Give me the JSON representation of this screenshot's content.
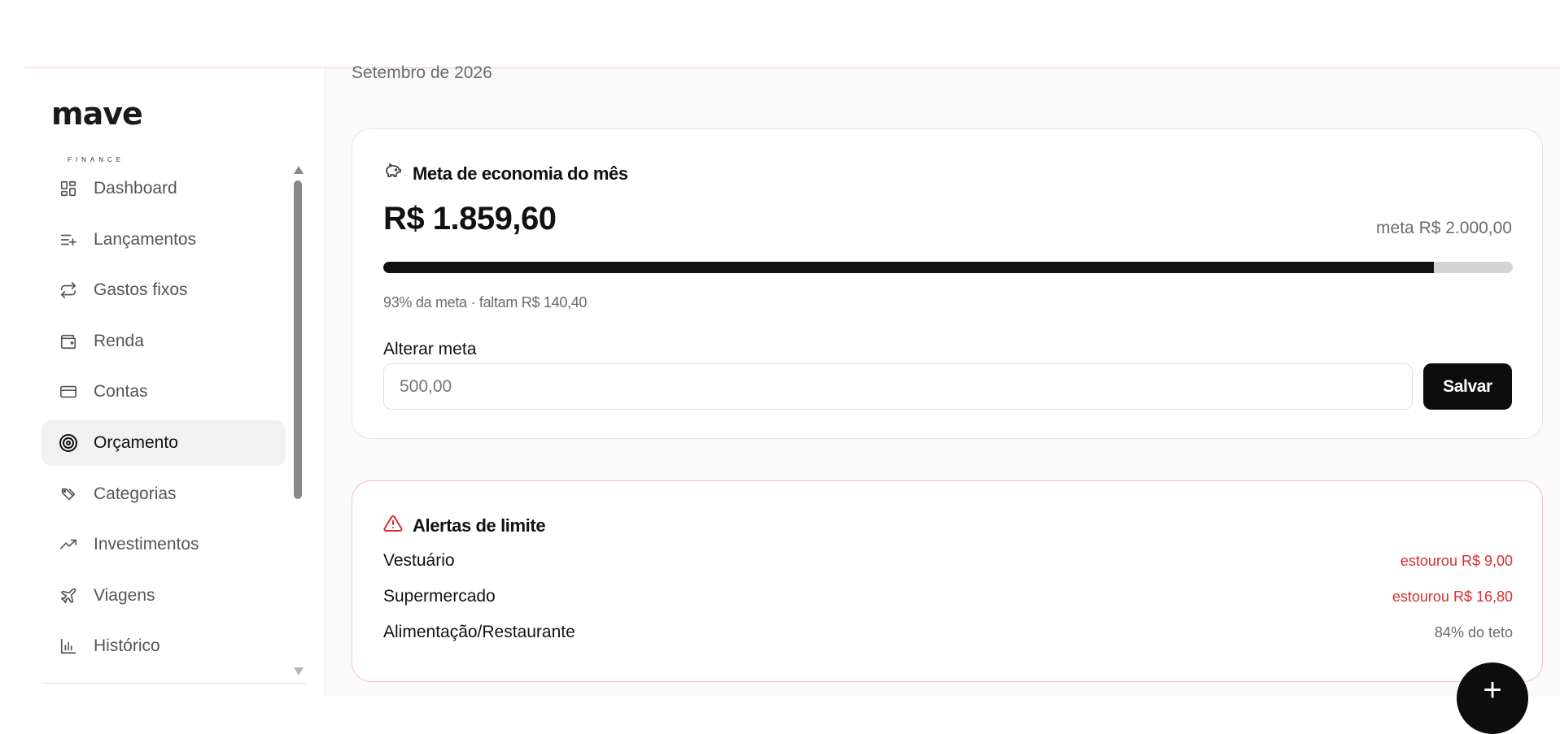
{
  "brand": {
    "name": "mave",
    "sub": "FINANCE"
  },
  "sidebar": {
    "items": [
      {
        "label": "Dashboard",
        "icon": "dashboard-icon",
        "active": false
      },
      {
        "label": "Lançamentos",
        "icon": "list-add-icon",
        "active": false
      },
      {
        "label": "Gastos fixos",
        "icon": "repeat-icon",
        "active": false
      },
      {
        "label": "Renda",
        "icon": "wallet-icon",
        "active": false
      },
      {
        "label": "Contas",
        "icon": "credit-card-icon",
        "active": false
      },
      {
        "label": "Orçamento",
        "icon": "target-icon",
        "active": true
      },
      {
        "label": "Categorias",
        "icon": "tags-icon",
        "active": false
      },
      {
        "label": "Investimentos",
        "icon": "trending-up-icon",
        "active": false
      },
      {
        "label": "Viagens",
        "icon": "plane-icon",
        "active": false
      },
      {
        "label": "Histórico",
        "icon": "bar-chart-icon",
        "active": false
      }
    ]
  },
  "main": {
    "month": "Setembro de 2026",
    "savings": {
      "title": "Meta de economia do mês",
      "amount": "R$ 1.859,60",
      "goal": "meta R$ 2.000,00",
      "progress_percent": 93,
      "progress_text": "93% da meta · faltam R$ 140,40",
      "field_label": "Alterar meta",
      "field_placeholder": "500,00",
      "save_label": "Salvar"
    },
    "alerts": {
      "title": "Alertas de limite",
      "rows": [
        {
          "name": "Vestuário",
          "status": "estourou R$ 9,00",
          "color": "#d92d2d"
        },
        {
          "name": "Supermercado",
          "status": "estourou R$ 16,80",
          "color": "#d92d2d"
        },
        {
          "name": "Alimentação/Restaurante",
          "status": "84% do teto",
          "color": "#6b6b6b"
        }
      ]
    },
    "fab_label": "+"
  },
  "colors": {
    "accent": "#0d0d0d",
    "danger": "#d92d2d",
    "muted": "#6b6b6b"
  }
}
